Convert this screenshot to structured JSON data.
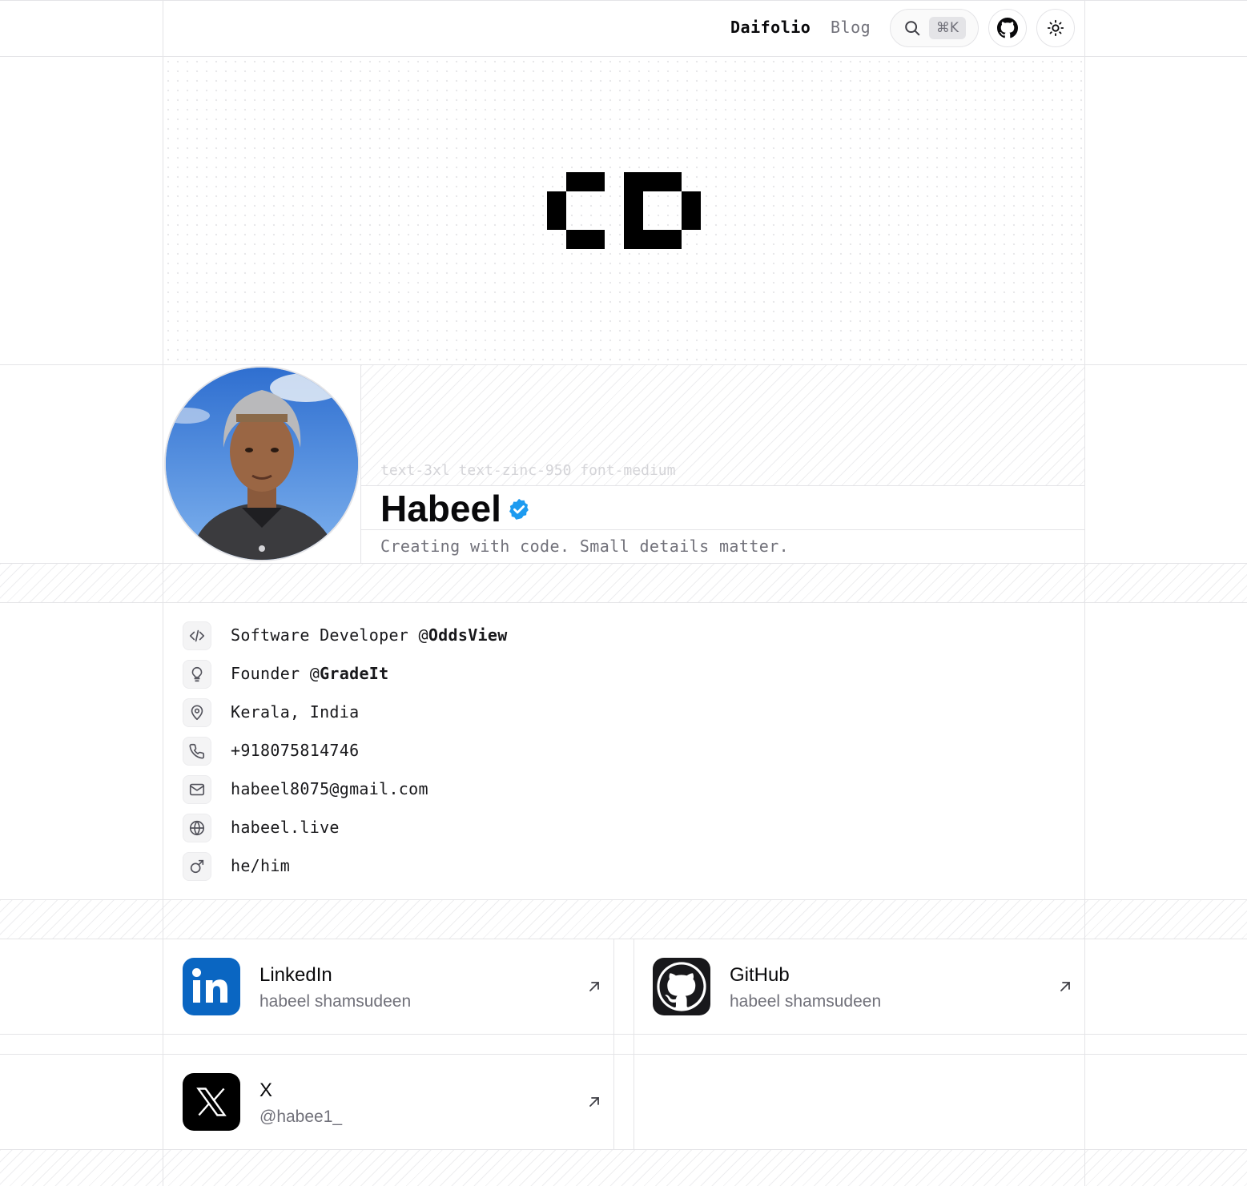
{
  "nav": {
    "brand": "Daifolio",
    "blog": "Blog",
    "search_shortcut": "⌘K"
  },
  "profile": {
    "style_hint": "text-3xl text-zinc-950 font-medium",
    "name": "Habeel",
    "tagline": "Creating with code. Small details matter."
  },
  "info": [
    {
      "icon": "code-icon",
      "prefix": "Software Developer @",
      "strong": "OddsView"
    },
    {
      "icon": "lightbulb-icon",
      "prefix": "Founder @",
      "strong": "GradeIt"
    },
    {
      "icon": "map-pin-icon",
      "text": "Kerala, India"
    },
    {
      "icon": "phone-icon",
      "text": "+918075814746"
    },
    {
      "icon": "mail-icon",
      "text": "habeel8075@gmail.com"
    },
    {
      "icon": "globe-icon",
      "text": "habeel.live"
    },
    {
      "icon": "mars-icon",
      "text": "he/him"
    }
  ],
  "socials": [
    {
      "name": "LinkedIn",
      "handle": "habeel shamsudeen",
      "icon": "linkedin-icon",
      "color": "#0a66c2"
    },
    {
      "name": "GitHub",
      "handle": "habeel shamsudeen",
      "icon": "github-icon",
      "color": "#18181b"
    },
    {
      "name": "X",
      "handle": "@habee1_",
      "icon": "x-logo-icon",
      "color": "#000000"
    }
  ],
  "colors": {
    "verified": "#1d9bf0",
    "border": "#e4e4e7",
    "muted_text": "#71717a"
  }
}
